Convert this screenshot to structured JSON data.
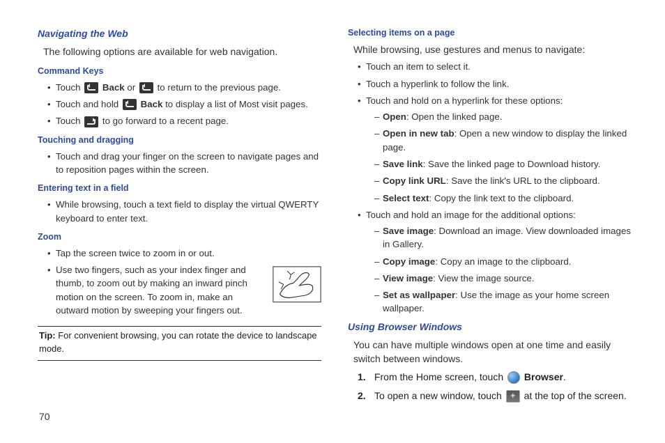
{
  "left": {
    "h_nav": "Navigating the Web",
    "nav_intro": "The following options are available for web navigation.",
    "h_cmd": "Command Keys",
    "cmd": {
      "l1a": "Touch ",
      "l1b": "Back",
      "l1c": " or ",
      "l1d": " to return to the previous page.",
      "l2a": "Touch and hold ",
      "l2b": "Back",
      "l2c": " to display a list of Most visit pages.",
      "l3a": "Touch ",
      "l3b": " to go forward to a recent page."
    },
    "h_touch": "Touching and dragging",
    "touch1": "Touch and drag your finger on the screen to navigate pages and to reposition pages within the screen.",
    "h_enter": "Entering text in a field",
    "enter1": "While browsing, touch a text field to display the virtual QWERTY keyboard to enter text.",
    "h_zoom": "Zoom",
    "zoom1": "Tap the screen twice to zoom in or out.",
    "zoom2": "Use two fingers, such as your index finger and thumb, to zoom out by making an inward pinch motion on the screen. To zoom in, make an outward motion by sweeping your fingers out.",
    "tip_label": "Tip:",
    "tip_text": " For convenient browsing, you can rotate the device to landscape mode."
  },
  "right": {
    "h_sel": "Selecting items on a page",
    "sel_intro": "While browsing, use gestures and menus to navigate:",
    "sel1": "Touch an item to select it.",
    "sel2": "Touch a hyperlink to follow the link.",
    "sel3": "Touch and hold on a hyperlink for these options:",
    "link": {
      "open_b": "Open",
      "open_t": ": Open the linked page.",
      "newtab_b": "Open in new tab",
      "newtab_t": ": Open a new window to display the linked page.",
      "save_b": "Save link",
      "save_t": ": Save the linked page to Download history.",
      "copy_b": "Copy link URL",
      "copy_t": ": Save the link's URL to the clipboard.",
      "seltxt_b": "Select text",
      "seltxt_t": ": Copy the link text to the clipboard."
    },
    "sel4": "Touch and hold an image for the additional options:",
    "img": {
      "save_b": "Save image",
      "save_t": ": Download an image. View downloaded images in Gallery.",
      "copy_b": "Copy image",
      "copy_t": ": Copy an image to the clipboard.",
      "view_b": "View image",
      "view_t": ": View the image source.",
      "wall_b": "Set as wallpaper",
      "wall_t": ": Use the image as your home screen wallpaper."
    },
    "h_win": "Using Browser Windows",
    "win_intro": "You can have multiple windows open at one time and easily switch between windows.",
    "s1a": "From the Home screen, touch ",
    "s1b": "Browser",
    "s1c": ".",
    "s2a": "To open a new window, touch ",
    "s2b": " at the top of the screen."
  },
  "page_number": "70"
}
